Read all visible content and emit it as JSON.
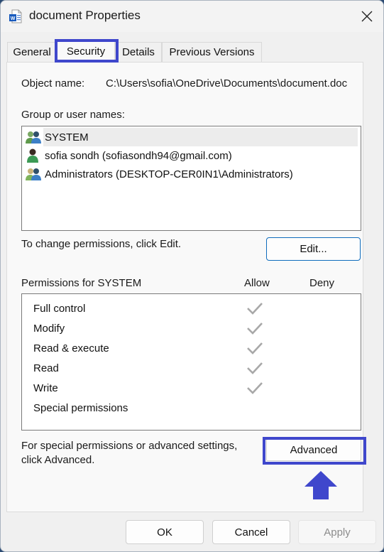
{
  "window": {
    "title": "document Properties",
    "app_icon": "word-document-icon",
    "close_icon": "close-icon"
  },
  "tabs": [
    {
      "label": "General",
      "active": false
    },
    {
      "label": "Security",
      "active": true
    },
    {
      "label": "Details",
      "active": false
    },
    {
      "label": "Previous Versions",
      "active": false
    }
  ],
  "security": {
    "object_name_label": "Object name:",
    "object_name_value": "C:\\Users\\sofia\\OneDrive\\Documents\\document.doc",
    "group_label": "Group or user names:",
    "users": [
      {
        "name": "SYSTEM",
        "icon": "user-group-icon",
        "selected": true
      },
      {
        "name": "sofia sondh (sofiasondh94@gmail.com)",
        "icon": "user-icon",
        "selected": false
      },
      {
        "name": "Administrators (DESKTOP-CER0IN1\\Administrators)",
        "icon": "user-group-icon",
        "selected": false
      }
    ],
    "change_hint": "To change permissions, click Edit.",
    "edit_button": "Edit...",
    "permissions_label": "Permissions for SYSTEM",
    "allow_header": "Allow",
    "deny_header": "Deny",
    "permissions": [
      {
        "name": "Full control",
        "allow": true,
        "deny": false
      },
      {
        "name": "Modify",
        "allow": true,
        "deny": false
      },
      {
        "name": "Read & execute",
        "allow": true,
        "deny": false
      },
      {
        "name": "Read",
        "allow": true,
        "deny": false
      },
      {
        "name": "Write",
        "allow": true,
        "deny": false
      },
      {
        "name": "Special permissions",
        "allow": false,
        "deny": false
      }
    ],
    "advanced_hint_line1": "For special permissions or advanced settings,",
    "advanced_hint_line2": "click Advanced.",
    "advanced_button": "Advanced"
  },
  "footer": {
    "ok": "OK",
    "cancel": "Cancel",
    "apply": "Apply"
  },
  "annotations": {
    "highlight_color": "#3f47cc",
    "arrow_color": "#3f47cc"
  }
}
